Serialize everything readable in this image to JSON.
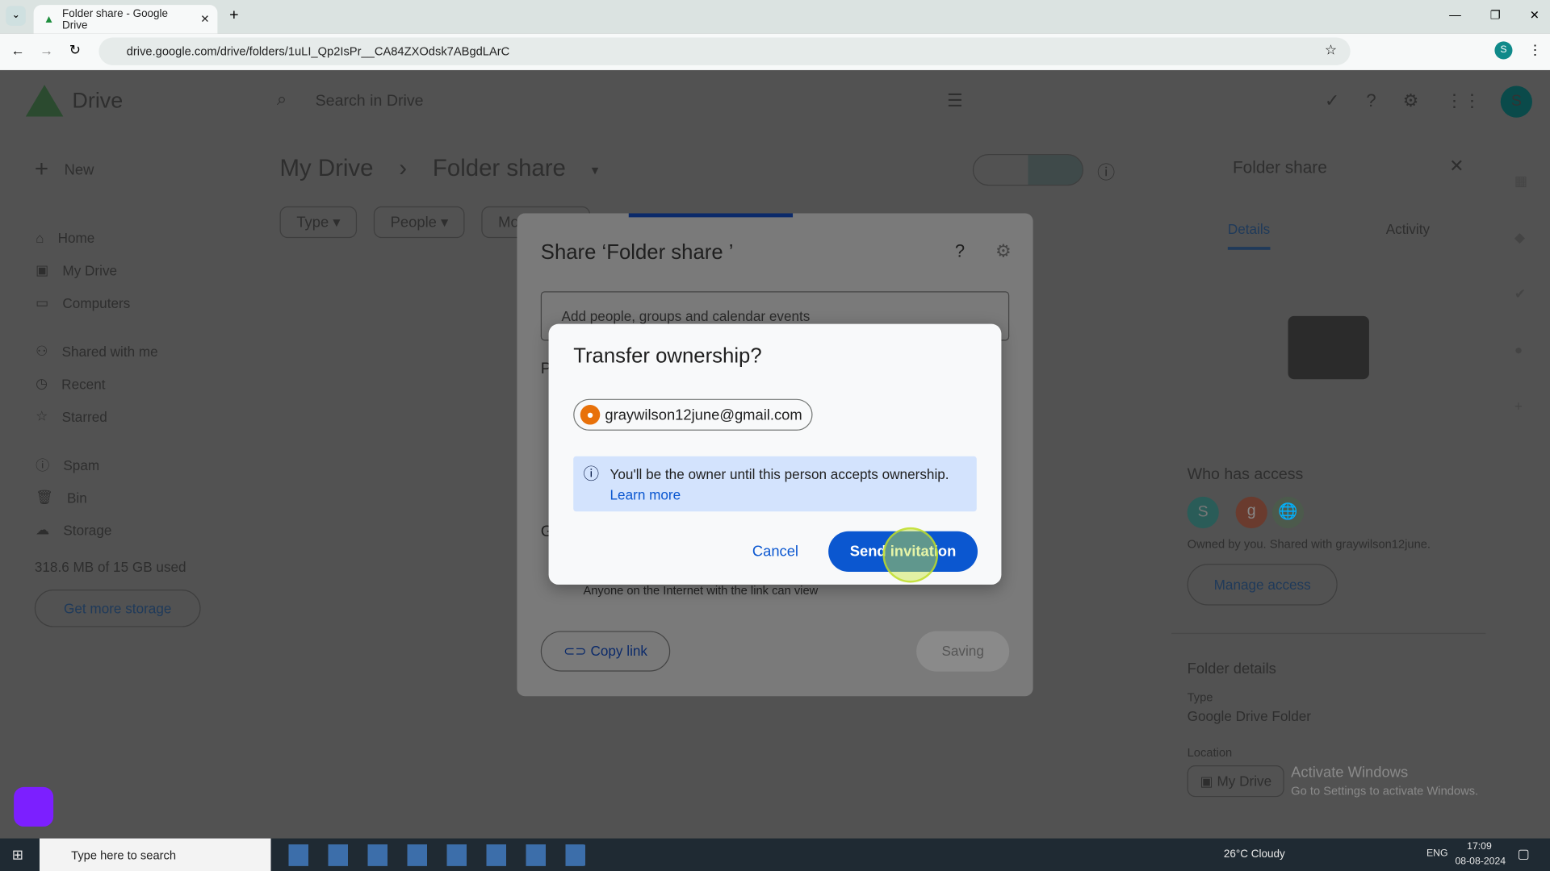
{
  "browser": {
    "tab_title": "Folder share - Google Drive",
    "url": "drive.google.com/drive/folders/1uLI_Qp2IsPr__CA84ZXOdsk7ABgdLArC",
    "profile_initial": "S"
  },
  "drive": {
    "app_name": "Drive",
    "search_placeholder": "Search in Drive",
    "new_label": "New",
    "avatar_initial": "S",
    "sidebar": [
      {
        "label": "Home",
        "icon": "home-icon"
      },
      {
        "label": "My Drive",
        "icon": "drive-icon"
      },
      {
        "label": "Computers",
        "icon": "computer-icon"
      },
      {
        "label": "Shared with me",
        "icon": "people-icon"
      },
      {
        "label": "Recent",
        "icon": "clock-icon"
      },
      {
        "label": "Starred",
        "icon": "star-icon"
      },
      {
        "label": "Spam",
        "icon": "spam-icon"
      },
      {
        "label": "Bin",
        "icon": "bin-icon"
      },
      {
        "label": "Storage",
        "icon": "cloud-icon"
      }
    ],
    "storage_used": "318.6 MB of 15 GB used",
    "get_storage": "Get more storage",
    "breadcrumb": {
      "root": "My Drive",
      "current": "Folder share"
    },
    "filters": [
      "Type",
      "People",
      "Mo"
    ]
  },
  "details": {
    "title": "Folder share",
    "tabs": [
      "Details",
      "Activity"
    ],
    "who_has_access": "Who has access",
    "avatars": [
      "S",
      "g"
    ],
    "owned_text": "Owned by you. Shared with graywilson12june.",
    "manage_access": "Manage access",
    "folder_details": "Folder details",
    "type_label": "Type",
    "type_value": "Google Drive Folder",
    "location_label": "Location",
    "location_value": "My Drive"
  },
  "share_dialog": {
    "title": "Share ‘Folder share ’",
    "add_placeholder": "Add people, groups and calendar events",
    "people_initial": "P",
    "general_initial": "G",
    "link_desc": "Anyone on the Internet with the link can view",
    "copy_link": "Copy link",
    "saving": "Saving"
  },
  "transfer_dialog": {
    "title": "Transfer ownership?",
    "email": "graywilson12june@gmail.com",
    "info": "You'll be the owner until this person accepts ownership.",
    "learn_more": "Learn more",
    "cancel": "Cancel",
    "send": "Send invitation"
  },
  "watermark": {
    "title": "Activate Windows",
    "subtitle": "Go to Settings to activate Windows."
  },
  "taskbar": {
    "search_placeholder": "Type here to search",
    "weather": "26°C  Cloudy",
    "lang": "ENG",
    "time": "17:09",
    "date": "08-08-2024"
  },
  "colors": {
    "primary": "#0b57d0",
    "info_bg": "#d3e3fd",
    "accent_orange": "#e8710a"
  }
}
